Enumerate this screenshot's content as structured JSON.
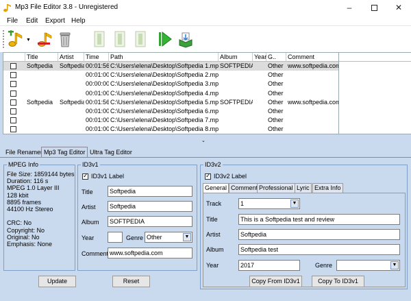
{
  "window": {
    "title": "Mp3 File Editor 3.8 - Unregistered"
  },
  "menu": [
    "File",
    "Edit",
    "Export",
    "Help"
  ],
  "grid": {
    "headers": [
      "Title",
      "Artist",
      "Time",
      "Path",
      "Album",
      "Year",
      "G..",
      "Comment"
    ],
    "rows": [
      {
        "title": "Softpedia",
        "artist": "Softpedia",
        "time": "00:01:56",
        "path": "C:\\Users\\elena\\Desktop\\Softpedia 1.mp3",
        "album": "SOFTPEDIA",
        "year": "",
        "genre": "Other",
        "comment": "www.softpedia.com"
      },
      {
        "title": "",
        "artist": "",
        "time": "00:01:00",
        "path": "C:\\Users\\elena\\Desktop\\Softpedia 2.mp3",
        "album": "",
        "year": "",
        "genre": "Other",
        "comment": ""
      },
      {
        "title": "",
        "artist": "",
        "time": "00:00:00",
        "path": "C:\\Users\\elena\\Desktop\\Softpedia 3.mp3",
        "album": "",
        "year": "",
        "genre": "Other",
        "comment": ""
      },
      {
        "title": "",
        "artist": "",
        "time": "00:01:00",
        "path": "C:\\Users\\elena\\Desktop\\Softpedia 4.mp3",
        "album": "",
        "year": "",
        "genre": "Other",
        "comment": ""
      },
      {
        "title": "Softpedia",
        "artist": "Softpedia",
        "time": "00:01:56",
        "path": "C:\\Users\\elena\\Desktop\\Softpedia 5.mp3",
        "album": "SOFTPEDIA",
        "year": "",
        "genre": "Other",
        "comment": "www.softpedia.com"
      },
      {
        "title": "",
        "artist": "",
        "time": "00:01:00",
        "path": "C:\\Users\\elena\\Desktop\\Softpedia 6.mp3",
        "album": "",
        "year": "",
        "genre": "Other",
        "comment": ""
      },
      {
        "title": "",
        "artist": "",
        "time": "00:01:00",
        "path": "C:\\Users\\elena\\Desktop\\Softpedia 7.mp3",
        "album": "",
        "year": "",
        "genre": "Other",
        "comment": ""
      },
      {
        "title": "",
        "artist": "",
        "time": "00:01:00",
        "path": "C:\\Users\\elena\\Desktop\\Softpedia 8.mp3",
        "album": "",
        "year": "",
        "genre": "Other",
        "comment": ""
      }
    ]
  },
  "bottom_tabs": [
    "File Renamer",
    "Mp3 Tag Editor",
    "Ultra Tag Editor"
  ],
  "mpeg": {
    "label": "MPEG Info",
    "lines": [
      "File Size: 1859144 bytes",
      "Duration: 116 s",
      "MPEG 1.0  Layer III",
      "128 kbit",
      "8895 frames",
      "44100 Hz Stereo",
      "",
      "CRC: No",
      "Copyright: No",
      "Original: No",
      "Emphasis: None"
    ]
  },
  "id3v1": {
    "label": "ID3v1",
    "checkbox": "ID3v1 Label",
    "title_label": "Title",
    "title": "Softpedia",
    "artist_label": "Artist",
    "artist": "Softpedia",
    "album_label": "Album",
    "album": "SOFTPEDIA",
    "year_label": "Year",
    "year": "",
    "genre_label": "Genre",
    "genre": "Other",
    "comment_label": "Comment",
    "comment": "www.softpedia.com"
  },
  "id3v2": {
    "label": "ID3v2",
    "checkbox": "ID3v2 Label",
    "tabs": [
      "General",
      "Comment",
      "Professional",
      "Lyric",
      "Extra Info"
    ],
    "track_label": "Track",
    "track": "1",
    "title_label": "Title",
    "title": "This is a Softpedia test and review",
    "artist_label": "Artist",
    "artist": "Softpedia",
    "album_label": "Album",
    "album": "Softpedia test",
    "year_label": "Year",
    "year": "2017",
    "genre_label": "Genre",
    "genre": "",
    "copy_from": "Copy From ID3v1",
    "copy_to": "Copy To ID3v1"
  },
  "buttons": {
    "update": "Update",
    "reset": "Reset"
  },
  "colors": {
    "accent": "#2a7de1",
    "panel": "#c9d9ee",
    "selected_row": "#dcdcdc"
  }
}
